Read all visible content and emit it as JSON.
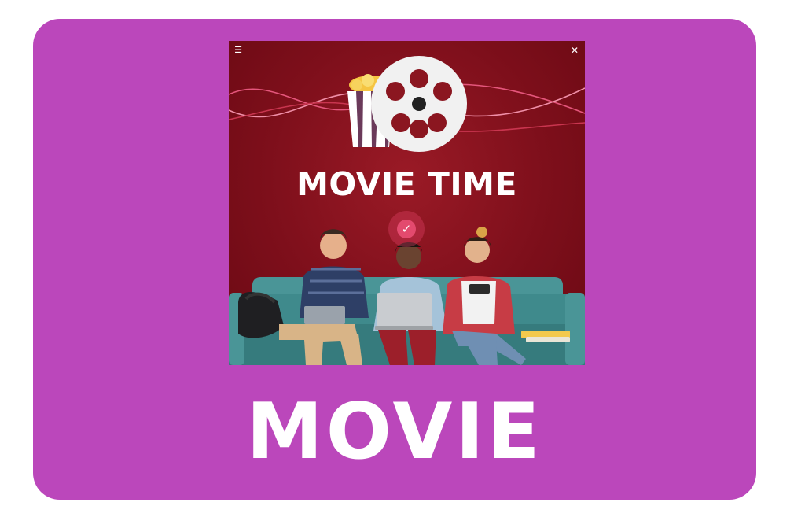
{
  "poster": {
    "title": "MOVIE TIME",
    "menu_icon": "☰",
    "close_icon": "✕",
    "check_icon": "✓"
  },
  "footer": {
    "label": "MOVIE"
  },
  "colors": {
    "card_background": "#bb47bb",
    "poster_background": "#7e0f1b",
    "sofa": "#3f8a8c",
    "accent_pink": "#e34a6e"
  }
}
